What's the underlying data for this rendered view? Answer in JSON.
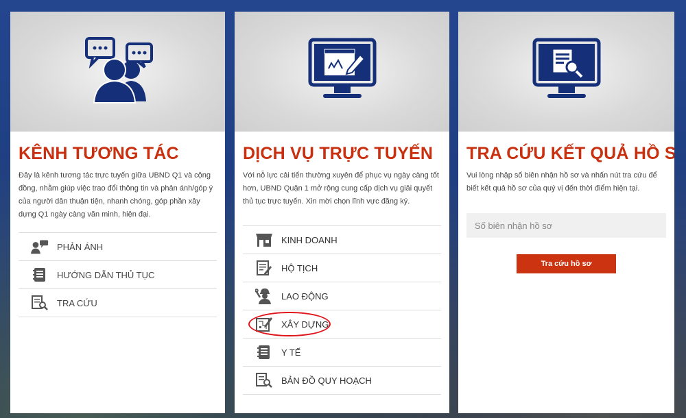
{
  "colors": {
    "accent": "#c8300f",
    "icon_blue": "#152f78",
    "highlight": "#e0141a"
  },
  "cards": [
    {
      "title": "KÊNH TƯƠNG TÁC",
      "hero_icon": "people-chat-icon",
      "description": "Đây là kênh tương tác trực tuyến giữa UBND Q1 và cộng đồng, nhằm giúp việc trao đổi thông tin và phản ánh/góp ý của người dân thuận tiện, nhanh chóng, góp phần xây dựng Q1 ngày càng văn minh, hiện đại.",
      "menu": [
        {
          "label": "PHẢN ÁNH",
          "icon": "feedback-person-icon"
        },
        {
          "label": "HƯỚNG DẪN THỦ TỤC",
          "icon": "guide-book-icon"
        },
        {
          "label": "TRA CỨU",
          "icon": "lookup-document-icon"
        }
      ]
    },
    {
      "title": "DỊCH VỤ TRỰC TUYẾN",
      "hero_icon": "monitor-edit-icon",
      "description": "Với nỗ lực cải tiến thường xuyên để phục vụ ngày càng tốt hơn, UBND Quận 1 mở rộng cung cấp dịch vụ giải quyết thủ tục trực tuyến. Xin mời chọn lĩnh vực đăng ký.",
      "menu": [
        {
          "label": "KINH DOANH",
          "icon": "storefront-icon"
        },
        {
          "label": "HỘ TỊCH",
          "icon": "civil-record-icon"
        },
        {
          "label": "LAO ĐỘNG",
          "icon": "worker-icon"
        },
        {
          "label": "XÂY DỰNG",
          "icon": "blueprint-icon",
          "highlighted": true
        },
        {
          "label": "Y TẾ",
          "icon": "health-book-icon"
        },
        {
          "label": "BẢN ĐỒ QUY HOẠCH",
          "icon": "planning-map-icon"
        }
      ]
    },
    {
      "title": "TRA CỨU KẾT QUẢ HỒ SƠ",
      "hero_icon": "monitor-search-icon",
      "description": "Vui lòng nhập số biên nhận hồ sơ và nhấn nút tra cứu để biết kết quả hồ sơ của quý vị đến thời điểm hiện tại.",
      "search": {
        "placeholder": "Số biên nhận hồ sơ",
        "value": "",
        "button_label": "Tra cứu hồ sơ"
      }
    }
  ]
}
